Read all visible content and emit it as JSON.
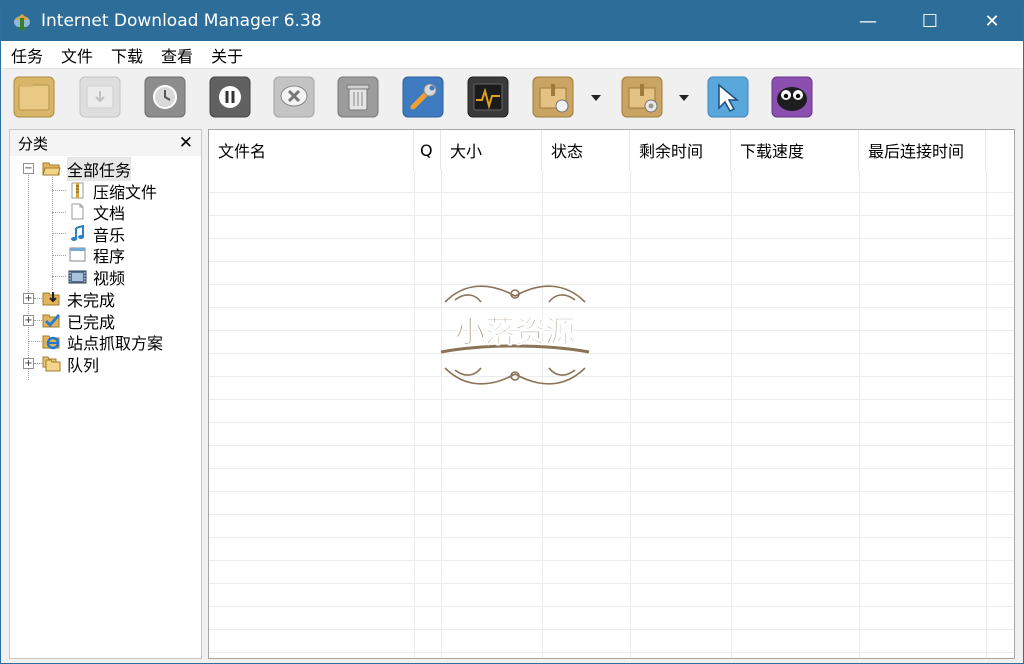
{
  "window": {
    "title": "Internet Download Manager 6.38",
    "minimize_glyph": "—",
    "maximize_glyph": "☐",
    "close_glyph": "✕"
  },
  "menu": [
    "任务",
    "文件",
    "下载",
    "查看",
    "关于"
  ],
  "toolbar": {
    "buttons": [
      "add-url-icon",
      "resume-icon",
      "scheduler-icon",
      "stop-icon",
      "delete-icon",
      "delete-completed-icon",
      "options-icon",
      "speed-limiter-icon",
      "start-queue-icon",
      "stop-queue-icon",
      "grabber-icon",
      "tell-friend-icon"
    ]
  },
  "sidebar": {
    "title": "分类",
    "close_glyph": "✕",
    "nodes": {
      "all": "全部任务",
      "compressed": "压缩文件",
      "documents": "文档",
      "music": "音乐",
      "programs": "程序",
      "video": "视频",
      "unfinished": "未完成",
      "finished": "已完成",
      "grabber": "站点抓取方案",
      "queues": "队列"
    }
  },
  "table": {
    "columns": {
      "filename": "文件名",
      "q": "Q",
      "size": "大小",
      "status": "状态",
      "time_left": "剩余时间",
      "speed": "下载速度",
      "last_try": "最后连接时间"
    }
  },
  "watermark": {
    "text": "小落资源"
  },
  "colors": {
    "titlebar": "#2d6d9a",
    "watermark": "#8a7356"
  }
}
